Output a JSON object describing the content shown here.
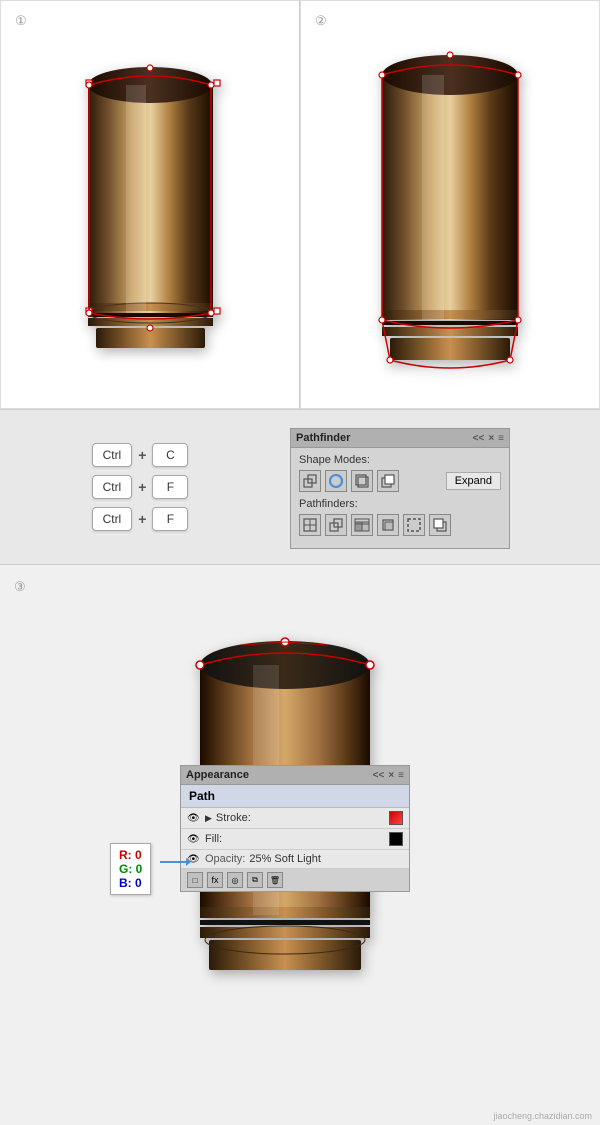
{
  "steps": {
    "step1": {
      "label": "①"
    },
    "step2": {
      "label": "②"
    },
    "step3": {
      "label": "③"
    }
  },
  "keyboard": {
    "row1": {
      "key1": "Ctrl",
      "key2": "C"
    },
    "row2": {
      "key1": "Ctrl",
      "key2": "F"
    },
    "row3": {
      "key1": "Ctrl",
      "key2": "F"
    },
    "plus": "+"
  },
  "pathfinder": {
    "title": "Pathfinder",
    "close": "×",
    "collapse": "<<",
    "menu": "≡",
    "shape_modes_label": "Shape Modes:",
    "pathfinders_label": "Pathfinders:",
    "expand_label": "Expand"
  },
  "appearance": {
    "title": "Appearance",
    "close": "×",
    "collapse": "<<",
    "menu": "≡",
    "path_label": "Path",
    "stroke_label": "Stroke:",
    "fill_label": "Fill:",
    "opacity_label": "Opacity:",
    "opacity_value": "25% Soft Light"
  },
  "rgb": {
    "r_label": "R: 0",
    "g_label": "G: 0",
    "b_label": "B: 0"
  },
  "watermark": "jiaocheng.chazidian.com"
}
